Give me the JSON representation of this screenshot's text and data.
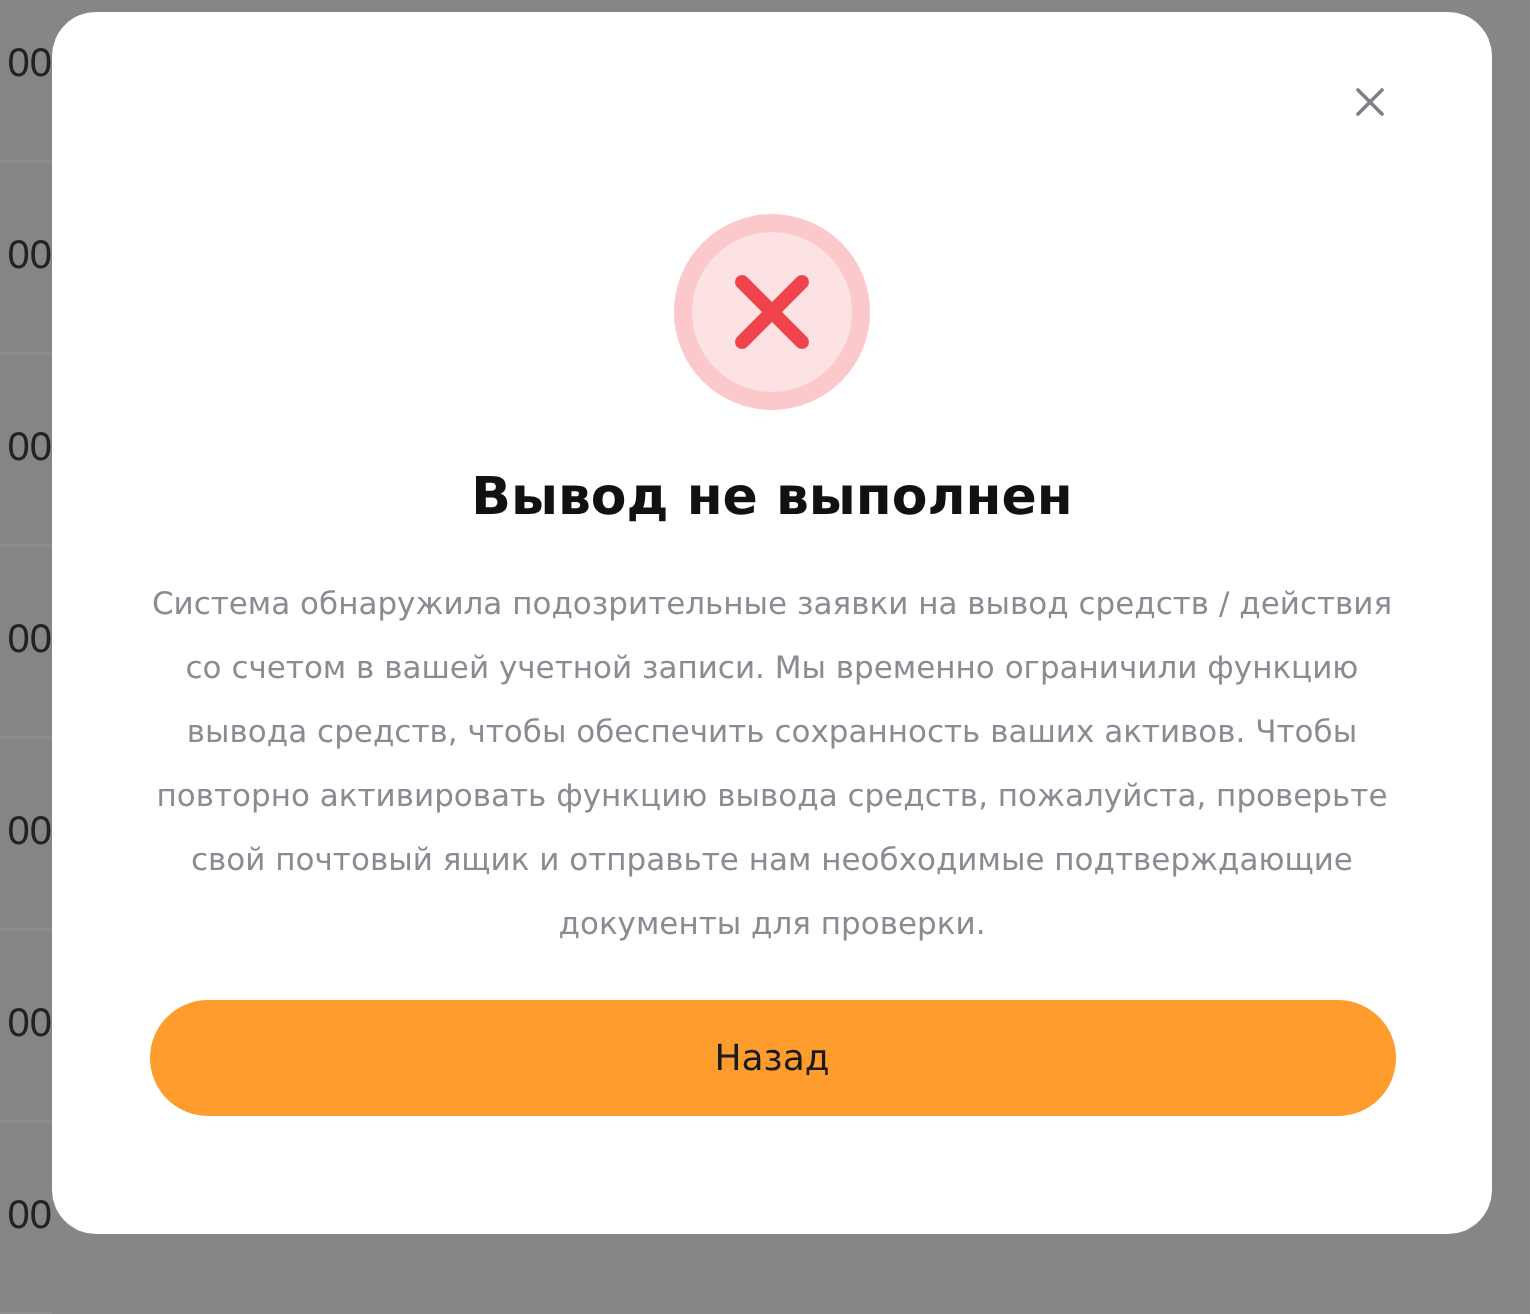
{
  "background_rows": [
    {
      "amount": "00"
    },
    {
      "amount": "00"
    },
    {
      "amount": "00"
    },
    {
      "amount": "00"
    },
    {
      "amount": "00"
    },
    {
      "amount": "00"
    },
    {
      "amount": "00"
    }
  ],
  "dialog": {
    "error": true,
    "title": "Вывод не выполнен",
    "message": "Система обнаружила подозрительные заявки на вывод средств / действия со счетом в вашей учетной записи. Мы временно ограничили функцию вывода средств, чтобы обеспечить сохранность ваших активов. Чтобы повторно активировать функцию вывода средств, пожалуйста, проверьте свой почтовый ящик и отправьте нам необходимые подтверждающие документы для проверки.",
    "button": "Назад"
  }
}
